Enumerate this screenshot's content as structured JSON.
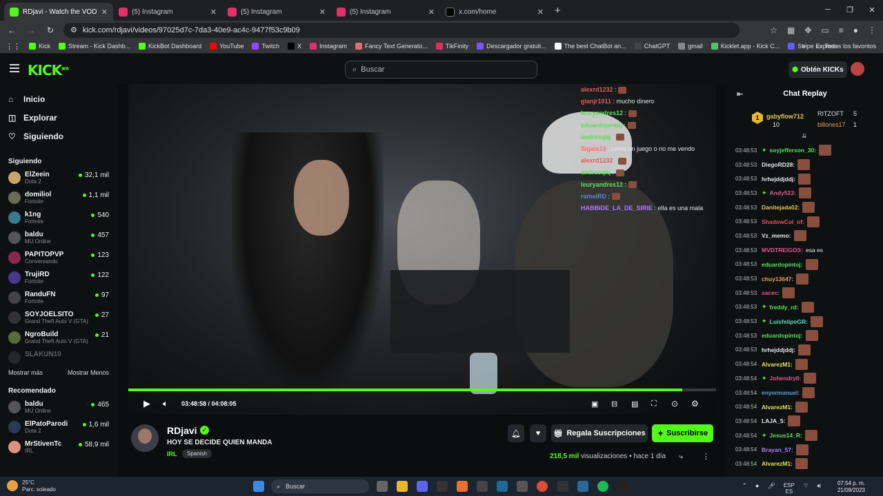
{
  "tabs": [
    {
      "title": "RDjavi - Watch the VOD on Kick",
      "color": "#53fc18",
      "active": true
    },
    {
      "title": "(5) Instagram",
      "color": "#e1306c"
    },
    {
      "title": "(5) Instagram",
      "color": "#e1306c"
    },
    {
      "title": "(5) Instagram",
      "color": "#e1306c"
    },
    {
      "title": "x.com/home",
      "color": "#000000"
    }
  ],
  "url": "kick.com/rdjavi/videos/97025d7c-7da3-40e9-ac4c-9477f53c9b09",
  "bookmarks": [
    "Kick",
    "Stream - Kick Dashb...",
    "KickBot Dashboard",
    "YouTube",
    "Twitch",
    "X",
    "Instagram",
    "Fancy Text Generato...",
    "TikFinity",
    "Descargador gratuit...",
    "The best ChatBot an...",
    "ChatGPT",
    "gmail",
    "Kicklet.app - Kick C...",
    "Stripe Express"
  ],
  "bookmarks_all": "Todos los favoritos",
  "logo": "KICK",
  "logo_beta": "BETA",
  "search_placeholder": "Buscar",
  "get_kicks": "Obtén KICKs",
  "nav": [
    "Inicio",
    "Explorar",
    "Siguiendo"
  ],
  "following_title": "Siguiendo",
  "following": [
    {
      "name": "ElZeein",
      "game": "Dota 2",
      "viewers": "32,1 mil",
      "color": "#c9a46a"
    },
    {
      "name": "domiliol",
      "game": "Fortnite",
      "viewers": "1,1 mil",
      "color": "#6b6b5a"
    },
    {
      "name": "k1ng",
      "game": "Fortnite",
      "viewers": "540",
      "color": "#3a7a8a"
    },
    {
      "name": "baldu",
      "game": "MU Online",
      "viewers": "457",
      "color": "#555"
    },
    {
      "name": "PAPITOPVP",
      "game": "Conversando",
      "viewers": "123",
      "color": "#8a2a4a"
    },
    {
      "name": "TrujiRD",
      "game": "Fortnite",
      "viewers": "122",
      "color": "#4a3a8a"
    },
    {
      "name": "RanduFN",
      "game": "Fortnite",
      "viewers": "97",
      "color": "#444"
    },
    {
      "name": "SOYJOELSITO",
      "game": "Grand Theft Auto V (GTA)",
      "viewers": "27",
      "color": "#333"
    },
    {
      "name": "NgroBuild",
      "game": "Grand Theft Auto V (GTA)",
      "viewers": "21",
      "color": "#5a6a3a"
    }
  ],
  "offline": "SLAKUN10",
  "show_more": "Mostrar más",
  "show_less": "Mostrar Menos",
  "recommended_title": "Recomendado",
  "recommended": [
    {
      "name": "baldu",
      "game": "MU Online",
      "viewers": "465",
      "color": "#555"
    },
    {
      "name": "ElPatoParodi",
      "game": "Dota 2",
      "viewers": "1,6 mil",
      "color": "#2a3a5a"
    },
    {
      "name": "MrStivenTc",
      "game": "IRL",
      "viewers": "58,9 mil",
      "color": "#e09080"
    }
  ],
  "overlay_chat": [
    {
      "u": "alexrd1232",
      "t": "",
      "c": "#e05a5a"
    },
    {
      "u": "gianjr1011",
      "t": "mucho dinero",
      "c": "#e05a5a"
    },
    {
      "u": "leuryandres12",
      "t": "",
      "c": "#5ae05a"
    },
    {
      "u": "eduardopintoj",
      "t": "",
      "c": "#5ae05a"
    },
    {
      "u": "andresqlq",
      "t": "",
      "c": "#5ae05a"
    },
    {
      "u": "Sigala13",
      "t": "como un juego o no me vendo",
      "c": "#ff6b6b"
    },
    {
      "u": "alexrd1232",
      "t": "",
      "c": "#e05a5a"
    },
    {
      "u": "andresqlq",
      "t": "",
      "c": "#5ae05a"
    },
    {
      "u": "leuryandres12",
      "t": "",
      "c": "#5ae05a"
    },
    {
      "u": "ramelRD",
      "t": "",
      "c": "#5a8ae0"
    },
    {
      "u": "HABBIDE_LA_DE_SIRIE",
      "t": "ella es una mala",
      "c": "#b07aff"
    }
  ],
  "player": {
    "time": "03:48:58 / 04:08:05",
    "progress": 0.943
  },
  "streamer": {
    "name": "RDjavi",
    "title": "HOY SE DECIDE QUIEN MANDA",
    "category": "IRL",
    "language": "Spanish",
    "views": "218,5 mil",
    "views_label": "visualizaciones",
    "ago": "hace 1 día"
  },
  "gift_label": "Regala Suscripciones",
  "subscribe_label": "Suscribirse",
  "chat_title": "Chat Replay",
  "pinned": {
    "u1": "gabyflow712",
    "n1": "10",
    "u2": "RITZOFT",
    "n2": "5",
    "u3": "billones17",
    "n3": "1",
    "rank": "1"
  },
  "chat": [
    {
      "ts": "03:48:53",
      "u": "soyjefferson_30:",
      "c": "#5ae05a",
      "badge": true,
      "t": ""
    },
    {
      "ts": "03:48:53",
      "u": "DiegoRD28:",
      "c": "#e8e8e8",
      "t": ""
    },
    {
      "ts": "03:48:53",
      "u": "hrhejddjddj:",
      "c": "#e8e8e8",
      "t": ""
    },
    {
      "ts": "03:48:53",
      "u": "Andy523:",
      "c": "#e05a8a",
      "badge": true,
      "t": ""
    },
    {
      "ts": "03:48:53",
      "u": "Danitejada02:",
      "c": "#e8c85a",
      "t": ""
    },
    {
      "ts": "03:48:53",
      "u": "ShadowCol_of:",
      "c": "#e05a5a",
      "t": ""
    },
    {
      "ts": "03:48:53",
      "u": "Vz_memo:",
      "c": "#e8e8e8",
      "t": ""
    },
    {
      "ts": "03:48:53",
      "u": "MVDTREIGOS:",
      "c": "#e05a8a",
      "t": "esa es"
    },
    {
      "ts": "03:48:53",
      "u": "eduardopintoj:",
      "c": "#5ae05a",
      "t": ""
    },
    {
      "ts": "03:48:53",
      "u": "chuy13647:",
      "c": "#e8a05a",
      "t": ""
    },
    {
      "ts": "03:48:53",
      "u": "sacec:",
      "c": "#e05a8a",
      "t": ""
    },
    {
      "ts": "03:48:53",
      "u": "freddy_rd:",
      "c": "#5ae05a",
      "badge": true,
      "t": ""
    },
    {
      "ts": "03:48:53",
      "u": "LuisfelipeGR:",
      "c": "#5ae0c0",
      "badge": true,
      "t": ""
    },
    {
      "ts": "03:48:53",
      "u": "eduardopintoj:",
      "c": "#5ae05a",
      "t": ""
    },
    {
      "ts": "03:48:53",
      "u": "hrhejddjddj:",
      "c": "#e8e8e8",
      "t": ""
    },
    {
      "ts": "03:48:54",
      "u": "AlvarezM1:",
      "c": "#e8e05a",
      "t": ""
    },
    {
      "ts": "03:48:54",
      "u": "Johendry8:",
      "c": "#e05a8a",
      "badge": true,
      "t": ""
    },
    {
      "ts": "03:48:54",
      "u": "enyermanuel:",
      "c": "#5aa0e0",
      "t": ""
    },
    {
      "ts": "03:48:54",
      "u": "AlvarezM1:",
      "c": "#e8e05a",
      "t": ""
    },
    {
      "ts": "03:48:54",
      "u": "LAJA_5:",
      "c": "#e8e8e8",
      "t": ""
    },
    {
      "ts": "03:48:54",
      "u": "Jesus14_R:",
      "c": "#5ae05a",
      "badge": true,
      "t": ""
    },
    {
      "ts": "03:48:54",
      "u": "Brayan_57:",
      "c": "#b07aff",
      "t": ""
    },
    {
      "ts": "03:48:54",
      "u": "AlvarezM1:",
      "c": "#e8e05a",
      "t": ""
    }
  ],
  "taskbar": {
    "search": "Buscar",
    "weather": "25°C",
    "weather_desc": "Parc. soleado",
    "lang": "ESP",
    "region": "ES",
    "time": "07:54 p. m.",
    "date": "21/09/2023"
  }
}
